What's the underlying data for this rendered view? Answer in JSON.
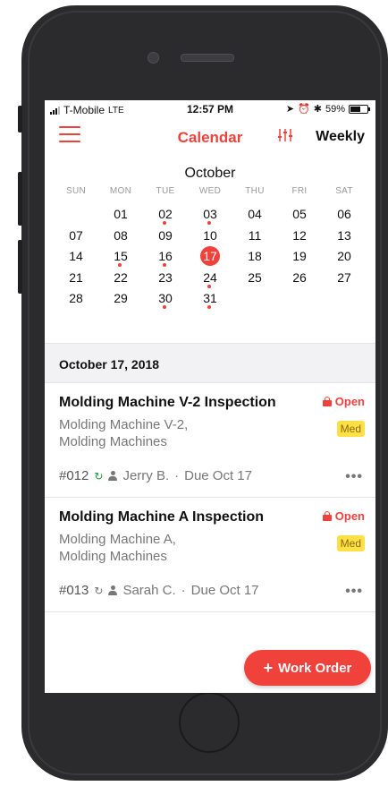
{
  "status_bar": {
    "carrier": "T-Mobile",
    "network": "LTE",
    "time": "12:57 PM",
    "battery": "59%",
    "battery_fraction": 0.59
  },
  "nav": {
    "title": "Calendar",
    "view_mode": "Weekly",
    "menu_icon": "hamburger-icon",
    "filter_icon": "filter-sliders-icon",
    "accent_color": "#f0413b"
  },
  "calendar": {
    "month": "October",
    "weekdays": [
      "SUN",
      "MON",
      "TUE",
      "WED",
      "THU",
      "FRI",
      "SAT"
    ],
    "weeks": [
      [
        "",
        "01",
        "02",
        "03",
        "04",
        "05",
        "06"
      ],
      [
        "07",
        "08",
        "09",
        "10",
        "11",
        "12",
        "13"
      ],
      [
        "14",
        "15",
        "16",
        "17",
        "18",
        "19",
        "20"
      ],
      [
        "21",
        "22",
        "23",
        "24",
        "25",
        "26",
        "27"
      ],
      [
        "28",
        "29",
        "30",
        "31",
        "",
        "",
        ""
      ]
    ],
    "selected_day": "17",
    "days_with_events": [
      "02",
      "03",
      "15",
      "16",
      "17",
      "24",
      "30",
      "31"
    ]
  },
  "date_header": "October 17, 2018",
  "work_orders": [
    {
      "title": "Molding Machine V-2 Inspection",
      "asset": "Molding Machine V-2,",
      "location": "Molding Machines",
      "status": "Open",
      "priority": "Med",
      "number": "#012",
      "assignee": "Jerry B.",
      "separator": "·",
      "due": "Due Oct 17",
      "repeat_color": "#22a33a",
      "more": "•••"
    },
    {
      "title": "Molding Machine A Inspection",
      "asset": "Molding Machine A,",
      "location": "Molding Machines",
      "status": "Open",
      "priority": "Med",
      "number": "#013",
      "assignee": "Sarah C.",
      "separator": "·",
      "due": "Due Oct 17",
      "repeat_color": "#777777",
      "more": "•••"
    }
  ],
  "fab": {
    "label": "Work Order",
    "plus": "+"
  }
}
